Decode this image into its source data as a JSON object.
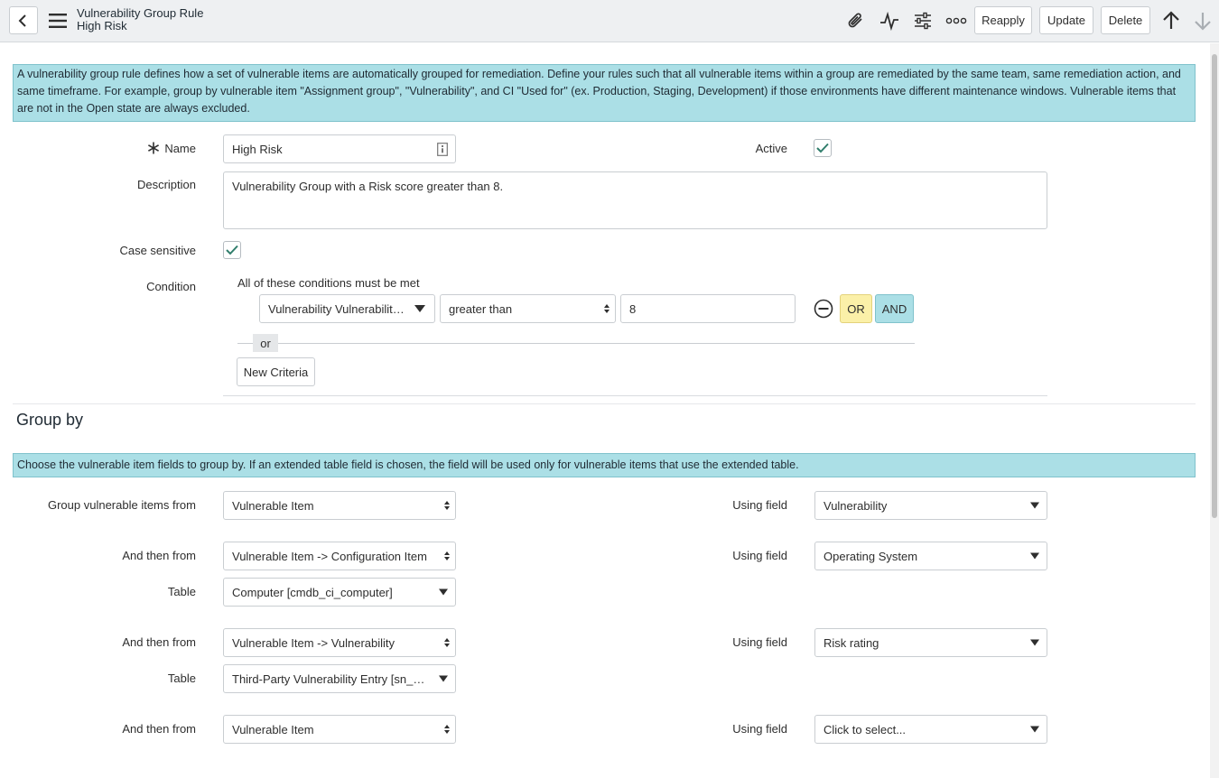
{
  "header": {
    "title": "Vulnerability Group Rule",
    "subtitle": "High Risk",
    "buttons": {
      "reapply": "Reapply",
      "update": "Update",
      "delete": "Delete"
    },
    "icons": [
      "back-icon",
      "menu-icon",
      "paperclip-icon",
      "activity-icon",
      "sliders-icon",
      "more-icon",
      "arrow-up-icon",
      "arrow-down-icon"
    ]
  },
  "info_top": "A vulnerability group rule defines how a set of vulnerable items are automatically grouped for remediation. Define your rules such that all vulnerable items within a group are remediated by the same team, same remediation action, and same timeframe. For example, group by vulnerable item \"Assignment group\", \"Vulnerability\", and CI \"Used for\" (ex. Production, Staging, Development) if those environments have different maintenance windows. Vulnerable items that are not in the Open state are always excluded.",
  "form": {
    "name_label": "Name",
    "name_value": "High Risk",
    "active_label": "Active",
    "active_checked": true,
    "description_label": "Description",
    "description_value": "Vulnerability Group with a Risk score greater than 8.",
    "case_label": "Case sensitive",
    "case_checked": true,
    "condition_label": "Condition",
    "condition_heading": "All of these conditions must be met",
    "condition": {
      "field": "Vulnerability Vulnerability…",
      "operator": "greater than",
      "value": "8"
    },
    "or_btn": "OR",
    "and_btn": "AND",
    "or_separator": "or",
    "new_criteria": "New Criteria"
  },
  "group_by": {
    "title": "Group by",
    "info": "Choose the vulnerable item fields to group by. If an extended table field is chosen, the field will be used only for vulnerable items that use the extended table.",
    "rows": [
      {
        "label": "Group vulnerable items from",
        "from": "Vulnerable Item",
        "using_label": "Using field",
        "using": "Vulnerability"
      },
      {
        "label": "And then from",
        "from": "Vulnerable Item -> Configuration Item",
        "using_label": "Using field",
        "using": "Operating System",
        "table_label": "Table",
        "table": "Computer [cmdb_ci_computer]"
      },
      {
        "label": "And then from",
        "from": "Vulnerable Item -> Vulnerability",
        "using_label": "Using field",
        "using": "Risk rating",
        "table_label": "Table",
        "table": "Third-Party Vulnerability Entry [sn_vul..."
      },
      {
        "label": "And then from",
        "from": "Vulnerable Item",
        "using_label": "Using field",
        "using": "Click to select..."
      }
    ]
  },
  "colors": {
    "info_bg": "#abdfe6",
    "or_bg": "#fbf0a8",
    "and_bg": "#abdfe6",
    "check": "#2f7d6b"
  }
}
